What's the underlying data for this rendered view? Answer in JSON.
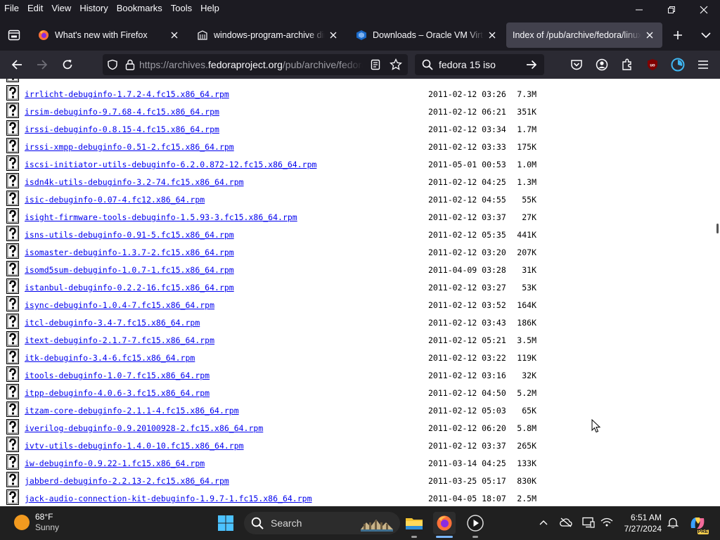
{
  "menubar": {
    "items": [
      "File",
      "Edit",
      "View",
      "History",
      "Bookmarks",
      "Tools",
      "Help"
    ]
  },
  "tabs": [
    {
      "title": "What's new with Firefox",
      "icon": "firefox-icon",
      "active": false
    },
    {
      "title": "windows-program-archive dire",
      "icon": "archive-icon",
      "active": false
    },
    {
      "title": "Downloads – Oracle VM Virtuall",
      "icon": "virtualbox-icon",
      "active": false
    },
    {
      "title": "Index of /pub/archive/fedora/linux/",
      "icon": "",
      "active": true
    }
  ],
  "urlbar": {
    "prefix": "https://archives.",
    "domain": "fedoraproject.org",
    "suffix": "/pub/archive/fedora/linux/"
  },
  "searchbar": {
    "query": "fedora 15 iso"
  },
  "files": [
    {
      "name": "irrlicht-debuginfo-1.7.2-4.fc15.x86_64.rpm",
      "date": "2011-02-12 03:26",
      "size": "7.3M"
    },
    {
      "name": "irsim-debuginfo-9.7.68-4.fc15.x86_64.rpm",
      "date": "2011-02-12 06:21",
      "size": "351K"
    },
    {
      "name": "irssi-debuginfo-0.8.15-4.fc15.x86_64.rpm",
      "date": "2011-02-12 03:34",
      "size": "1.7M"
    },
    {
      "name": "irssi-xmpp-debuginfo-0.51-2.fc15.x86_64.rpm",
      "date": "2011-02-12 03:33",
      "size": "175K"
    },
    {
      "name": "iscsi-initiator-utils-debuginfo-6.2.0.872-12.fc15.x86_64.rpm",
      "date": "2011-05-01 00:53",
      "size": "1.0M"
    },
    {
      "name": "isdn4k-utils-debuginfo-3.2-74.fc15.x86_64.rpm",
      "date": "2011-02-12 04:25",
      "size": "1.3M"
    },
    {
      "name": "isic-debuginfo-0.07-4.fc12.x86_64.rpm",
      "date": "2011-02-12 04:55",
      "size": "55K"
    },
    {
      "name": "isight-firmware-tools-debuginfo-1.5.93-3.fc15.x86_64.rpm",
      "date": "2011-02-12 03:37",
      "size": "27K"
    },
    {
      "name": "isns-utils-debuginfo-0.91-5.fc15.x86_64.rpm",
      "date": "2011-02-12 05:35",
      "size": "441K"
    },
    {
      "name": "isomaster-debuginfo-1.3.7-2.fc15.x86_64.rpm",
      "date": "2011-02-12 03:20",
      "size": "207K"
    },
    {
      "name": "isomd5sum-debuginfo-1.0.7-1.fc15.x86_64.rpm",
      "date": "2011-04-09 03:28",
      "size": "31K"
    },
    {
      "name": "istanbul-debuginfo-0.2.2-16.fc15.x86_64.rpm",
      "date": "2011-02-12 03:27",
      "size": "53K"
    },
    {
      "name": "isync-debuginfo-1.0.4-7.fc15.x86_64.rpm",
      "date": "2011-02-12 03:52",
      "size": "164K"
    },
    {
      "name": "itcl-debuginfo-3.4-7.fc15.x86_64.rpm",
      "date": "2011-02-12 03:43",
      "size": "186K"
    },
    {
      "name": "itext-debuginfo-2.1.7-7.fc15.x86_64.rpm",
      "date": "2011-02-12 05:21",
      "size": "3.5M"
    },
    {
      "name": "itk-debuginfo-3.4-6.fc15.x86_64.rpm",
      "date": "2011-02-12 03:22",
      "size": "119K"
    },
    {
      "name": "itools-debuginfo-1.0-7.fc15.x86_64.rpm",
      "date": "2011-02-12 03:16",
      "size": "32K"
    },
    {
      "name": "itpp-debuginfo-4.0.6-3.fc15.x86_64.rpm",
      "date": "2011-02-12 04:50",
      "size": "5.2M"
    },
    {
      "name": "itzam-core-debuginfo-2.1.1-4.fc15.x86_64.rpm",
      "date": "2011-02-12 05:03",
      "size": "65K"
    },
    {
      "name": "iverilog-debuginfo-0.9.20100928-2.fc15.x86_64.rpm",
      "date": "2011-02-12 06:20",
      "size": "5.8M"
    },
    {
      "name": "ivtv-utils-debuginfo-1.4.0-10.fc15.x86_64.rpm",
      "date": "2011-02-12 03:37",
      "size": "265K"
    },
    {
      "name": "iw-debuginfo-0.9.22-1.fc15.x86_64.rpm",
      "date": "2011-03-14 04:25",
      "size": "133K"
    },
    {
      "name": "jabberd-debuginfo-2.2.13-2.fc15.x86_64.rpm",
      "date": "2011-03-25 05:17",
      "size": "830K"
    },
    {
      "name": "jack-audio-connection-kit-debuginfo-1.9.7-1.fc15.x86_64.rpm",
      "date": "2011-04-05 18:07",
      "size": "2.5M"
    }
  ],
  "taskbar": {
    "weather": {
      "temp": "68°F",
      "condition": "Sunny"
    },
    "search_placeholder": "Search",
    "clock": {
      "time": "6:51 AM",
      "date": "7/27/2024"
    },
    "copilot_badge": "PRE"
  },
  "colors": {
    "link": "#0000ee",
    "chrome_dark": "#1c1b22",
    "toolbar": "#2b2a33",
    "active_tab": "#42414d",
    "taskbar": "#202020"
  }
}
